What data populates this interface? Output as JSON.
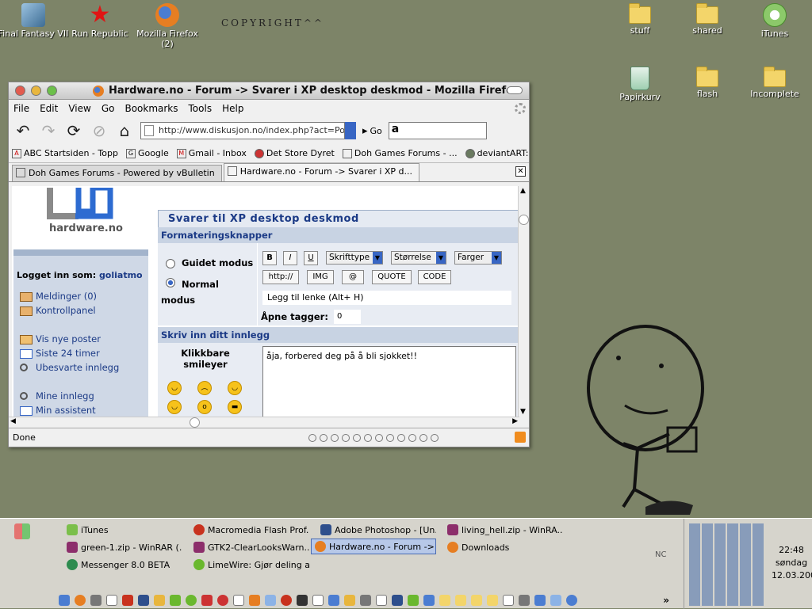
{
  "desktop": {
    "icons_left": [
      {
        "label": "Final Fantasy VII",
        "color": "#6aa0c8"
      },
      {
        "label": "Run Republic",
        "color": "#e01414"
      },
      {
        "label": "Mozilla Firefox (2)",
        "color": "#e67e22"
      }
    ],
    "icons_right": [
      {
        "label": "stuff"
      },
      {
        "label": "shared"
      },
      {
        "label": "iTunes"
      },
      {
        "label": "Papirkurv"
      },
      {
        "label": "flash"
      },
      {
        "label": "Incomplete"
      }
    ],
    "copyright": "COPYRIGHT^^"
  },
  "window": {
    "title": "Hardware.no - Forum -> Svarer i XP desktop deskmod - Mozilla Firefox",
    "menu": [
      "File",
      "Edit",
      "View",
      "Go",
      "Bookmarks",
      "Tools",
      "Help"
    ],
    "url": "http://www.diskusjon.no/index.php?act=Po",
    "go_label": "Go",
    "bookmarks": [
      "ABC Startsiden - Topp",
      "Google",
      "Gmail - Inbox",
      "Det Store Dyret",
      "Doh Games Forums - ...",
      "deviantART: where ..."
    ],
    "tabs": [
      {
        "label": "Doh Games Forums - Powered by vBulletin",
        "active": false
      },
      {
        "label": "Hardware.no - Forum -> Svarer i XP d...",
        "active": true
      }
    ],
    "status": "Done"
  },
  "page": {
    "logo_text": "hardware.no",
    "logged_in_label": "Logget inn som:",
    "username": "goliatmo",
    "links_top": [
      "Meldinger (0)",
      "Kontrollpanel"
    ],
    "links_mid": [
      "Vis nye poster",
      "Siste 24 timer",
      "Ubesvarte innlegg"
    ],
    "links_bot": [
      "Mine innlegg",
      "Min assistent"
    ],
    "heading": "Svarer til XP desktop deskmod",
    "section_format": "Formateringsknapper",
    "mode_guided": "Guidet modus",
    "mode_normal": "Normal modus",
    "buttons_row1": [
      "B",
      "I",
      "U"
    ],
    "selects": [
      "Skrifttype",
      "Størrelse",
      "Farger"
    ],
    "buttons_row2": [
      "http://",
      "IMG",
      "@",
      "QUOTE",
      "CODE"
    ],
    "hint": "Legg til lenke (Alt+ H)",
    "open_tags_label": "Åpne tagger:",
    "open_tags_value": "0",
    "section_write": "Skriv inn ditt innlegg",
    "smiley_title": "Klikkbare smileyer",
    "post_text": "åja, forbered deg på å bli sjokket!!"
  },
  "taskbar": {
    "tasks": [
      {
        "label": "iTunes",
        "color": "#7bbf4a",
        "active": false
      },
      {
        "label": "Macromedia Flash Prof...",
        "color": "#c8321e",
        "active": false
      },
      {
        "label": "Adobe Photoshop - [Un...",
        "color": "#2e4f8c",
        "active": false
      },
      {
        "label": "living_hell.zip - WinRA...",
        "color": "#8c2e6b",
        "active": false
      },
      {
        "label": "green-1.zip - WinRAR (...",
        "color": "#8c2e6b",
        "active": false
      },
      {
        "label": "GTK2-ClearLooksWarn...",
        "color": "#8c2e6b",
        "active": false
      },
      {
        "label": "Hardware.no - Forum ->...",
        "color": "#e67e22",
        "active": true
      },
      {
        "label": "Downloads",
        "color": "#e67e22",
        "active": false
      },
      {
        "label": "Messenger 8.0 BETA",
        "color": "#2e8c4f",
        "active": false
      },
      {
        "label": "LimeWire: Gjør deling a...",
        "color": "#6ab82e",
        "active": false
      }
    ],
    "tray_label": "NC",
    "time": "22:48",
    "day": "søndag",
    "date": "12.03.2006"
  }
}
